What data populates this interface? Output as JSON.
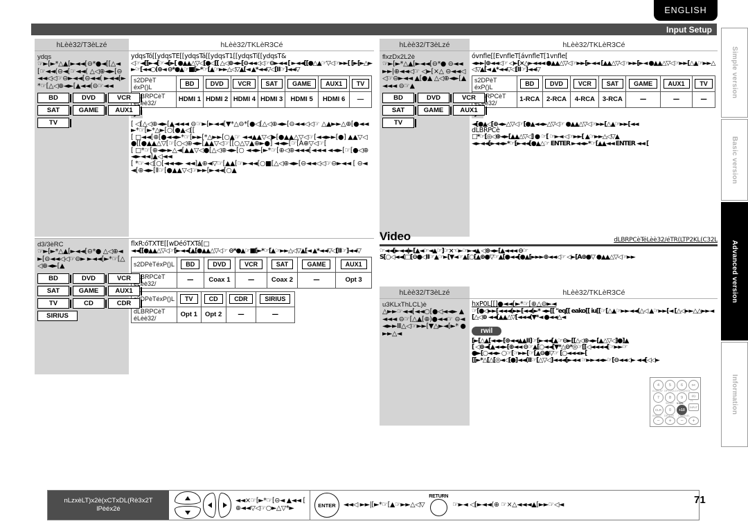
{
  "language_tab": {
    "label": "ENGLISH"
  },
  "page_header": {
    "title": "Input Setup"
  },
  "side_tabs": [
    {
      "label": "Simple version",
      "active": false
    },
    {
      "label": "Basic version",
      "active": false
    },
    {
      "label": "Advanced version",
      "active": true
    },
    {
      "label": "Information",
      "active": false
    }
  ],
  "panels": {
    "top_left": {
      "header_left": "hLèè32/T3èLzé",
      "header_right": "hLèè32/TKLèR3Cé",
      "left_title": "ydqs",
      "left_body": "☞►[►*△▲[►◄◄[⊖*●◄[[△◄[☞◄◄(⊖◄[☞◄◄( △◁⊕◄►[⊖◄◄◁◁☞⊖►◄◄[⊖◄◄( ►◄◄[►*☞[△◁⊕◄►[▲◄◄(⊖☞◄◄",
      "right_title": "ydqsTó[[ydqsTE[[ydqsTá[[ydqsT1[[ydqsTi[[ydqsT&",
      "right_body": "◁☞◄[[►◄[☞◄[►[ ●▲▲△▽◁[●◁[[ △◁⊕◄►[⊖◄◄◁◁☞⊖►◄◄ [ ►◄◄[[●△▲☞▽◁☞►►[ [►[►△►►☞[◄◄○(⊕◄ ⊖*●▲☞■[►*☞[▲☞►►△◁▽▲[◄ ▲*◄◄▽◁[Ⅱ☞]◄◄▽",
      "keys": [
        "BD",
        "DVD",
        "VCR",
        "SAT",
        "GAME",
        "AUX1",
        "TV"
      ],
      "tables": [
        {
          "row1_label": "s2DPèT éxP()L",
          "row2_label": "dLBRPCèT éLèè32/",
          "keys": [
            "BD",
            "DVD",
            "VCR",
            "SAT",
            "GAME",
            "AUX1",
            "TV"
          ],
          "values": [
            "HDMI 1",
            "HDMI 2",
            "HDMI 4",
            "HDMI 3",
            "HDMI 5",
            "HDMI 6",
            "—"
          ]
        }
      ],
      "notes": [
        "[ ◁[△◁⊕◄►[▲◄◄◄ ⊖☞►[►◄◄[▼*△⊖*[●◁[△◁⊕◄►[⊖◄◄◁◁☞ △▲►►△⊕[●◄◄►*☞[►*△►[○[●▲◁[[",
        "[ □◄◄[⊕[●◄◄►*☞[►►[*△►►[○▲☞ ◄◄▲▲▽◁▶[●▲▲△▽◁☞[◄◄►►[●] ▲▲▽◁●[[●▲▲△▽[☞[○◁⊕◄►[▲▲▽◁☞[[○△▽▲⊕►●] ◄◄►[☞[A⊕▽◁☞[",
        "[ □*☞[⊕◄►►△◄[▲▲▽◁●[△◁⊕◄►[○ ◄◄►[►*☞[⊕◁⊕◄◄◄[◄◄◄ ◄◄►[☞[●◁⊕◄►◄◄]▲◁◄◄",
        "[ *☞◄◁[○[◄◄◄► ◄◄]▲⊕◄▽☞[▲▲[☞►◄◄[○■[△◁⊕◄►[⊖◄◄◁◁☞⊖►◄◄ [ ⊖◄◄[⊕◄►[Ⅱ☞[●▲▲▽◁☞►►[►◄◄[○▲"
      ]
    },
    "top_right": {
      "header_left": "hLèè32/T3èLzé",
      "header_right": "hLèè32/TKLèR3Cé",
      "left_title": "flxzDx2L2è",
      "left_body": "☞►[►*△▲[►◄◄[⊖*● ⊖◄◄►►|⊕◄◄◁☞ ◁►[×△ ⊖◄◄◁◁☞⊖►◄◄ ▲[●▲ △◁⊕◄►[▲◄◄◄ ⊖☞▲",
      "right_title": "óvnfle[[EvnfleT[ávnfleT[1vnfle[",
      "right_body": "◄►►|⊕◄◄◁☞ ◁►[×△►◄◄◄ ●▲▲△▽◁☞►►[►◄◄ [▲▲△▽◁☞►►[►◄ ●▲▲△▽◁☞►►[△▲☞►►△◁▽▲[◄ ▲*◄◄▽◁[Ⅱ☞]◄◄▽",
      "keys": [
        "BD",
        "DVD",
        "VCR",
        "SAT",
        "GAME",
        "AUX1",
        "TV"
      ],
      "tables": [
        {
          "row1_label": "s2DPèT éxP()L",
          "row2_label": "dLBRPCèT éLèè32/",
          "keys": [
            "BD",
            "DVD",
            "VCR",
            "SAT",
            "GAME",
            "AUX1",
            "TV"
          ],
          "values": [
            "1-RCA",
            "2-RCA",
            "4-RCA",
            "3-RCA",
            "—",
            "—",
            "—"
          ]
        }
      ],
      "notes": [
        "◄[●▲◁[⊕◄►△▽◁☞[●▲◄◄►△▽◁☞ ●▲▲△▽◁☞►►[△▲☞►►[◄◄",
        "dLBRPCè",
        "□*☞[◎◁⊕◄►[▲▲△▽◁] ● ☞[ ☞►◄ ◁☞►►[ ▲☞►►△◁▽▲",
        "◄►◄◄[►◄◄►*☞[►◄◄[●▲△☞ ENTER ►◄◄►*☞[▲▲◄◄ ENTER ◄◄ ["
      ]
    },
    "bottom_left": {
      "header_left": "",
      "left_title": "d3/3èRC",
      "left_body": "☞►[►*△▲[►◄◄[⊖*● △◁⊕◄►[⊖◄◄◁◁☞⊖► ►◄◄[►*☞[△◁⊕◄►[▲",
      "right_title": "flxR:óTXTE[[wDéóTXTá[□",
      "right_body": "◄◄[[●▲▲△▽◁☞[►◄◄[▲[●▲▲△▽◁☞ ⊖*●▲☞■[►*☞[▲☞►►△◁▽▲[◄ ▲*◄◄▽◁[Ⅱ☞]◄◄▽",
      "keys": [
        "BD",
        "DVD",
        "VCR",
        "SAT",
        "GAME",
        "AUX1",
        "TV",
        "CD",
        "CDR",
        "SIRIUS"
      ],
      "tables": [
        {
          "row1_label": "s2DPèTéxP()L",
          "row2_label": "dLBRPCèT éLèè32/",
          "keys": [
            "BD",
            "DVD",
            "VCR",
            "SAT",
            "GAME",
            "AUX1"
          ],
          "values": [
            "—",
            "Coax 1",
            "—",
            "Coax 2",
            "—",
            "Opt 3"
          ]
        },
        {
          "row1_label": "s2DPèTéxP()L",
          "row2_label": "dLBRPCèT éLèè32/",
          "keys": [
            "TV",
            "CD",
            "CDR",
            "SIRIUS"
          ],
          "values": [
            "Opt 1",
            "Opt 2",
            "—",
            "—"
          ]
        }
      ]
    },
    "video_section": {
      "title": "Video",
      "reference": "dLBRPCèTéLèè32/éTR(LTP2KL(C32L",
      "body1": "☞◄◄[►◄◄|►[▲◄☞◄▲☞]☞×☜►☞►◄▲ ◁⊕◄►[▲◄◄◄ ⊖☞",
      "body2": "S[○◁◄◄(□[⊖●◁Ⅱ☞▲☞►[▼◄☞▲[○[▲⊕●▽☞▲[●◄◄[●▲[►►►⊕◄◄◁☞ ◁►[A⊕●▽ ●▲▲△▽◁☞►►"
    },
    "bottom_right": {
      "header_left": "hLèè32/T3èLzé",
      "header_right": "hLèè32/TKLèR3Cé",
      "left_title": "u3KLxThLCL)è",
      "left_body": "△►►☞◄◄[◄◄○[●◁◄◄► ▲◄◄◄ ⊖☞[△▲[⊕)●◄◄☞ ⊖◄◄►►Ⅲ△◁☞►►[▼△►◄[►* ●►►△◄",
      "right_title": "hxP0L[[]●◄◄[►*☞[⊕△⊖►◄",
      "right_body": "☞[●◁►►[◄◄◄(►►[◄◄(►* ◄►[[ \"eq[[ eako[[ iu[[☞[△▲☞►►◄◄(△◁ ▲☞►►[◄ [△◁►►△△►►◄[△◁⊕ ◄◄[▲▲△▽[◄◄◄(▼*◄ ●◄◄△◄",
      "pill": "rwil",
      "notes": [
        "[►[△▲[◄◄►[⊕◄◄▲▲Ⅱ]☞[►◄◄[▲☞⊖►[[△◁⊕◄►[▲△▽◁]●]▲",
        "[ ◁⊕◄[▲◄◄►[⊕◄◄ ⊖☞▲[○◄◄[▼*△⊖*◎☞[[◁◄◄◄◄[☞►►☞",
        "●►[○◄◄► ○☞[☞►►[☞[▲⊖●▽☞ [○◄◄◄ ►[",
        "[[►*△[△[◎◄◁[●]◄◄(Ⅱ☞[△▽◁]◄◄◄[►◄◄ ☞►►◄◄►☞[⊖◄◄◁► ◄◄[◁◁►"
      ]
    }
  },
  "remote": {
    "keys": [
      "4",
      "5",
      "6",
      "7",
      "8",
      "9",
      "CLR",
      "0",
      "+10"
    ],
    "captions": [
      "A.DELAY",
      "OPT/VOL",
      "DYN.EQ/VOL",
      "SLEEP",
      "V.SEL",
      "INSERT",
      "DELETE",
      "CHANNEL",
      "TUNING",
      "PRESET"
    ],
    "side_keys": [
      "I/⏻",
      "TV",
      "INPUT"
    ]
  },
  "bottom_bar": {
    "label_line1": "nLzxèLT)x2è(xCTxDL(Rè3x2T",
    "label_line2": "lPèéx2é",
    "cursor_text1": "◄◄×☞[►*☞[⊖◄ ▲◄◄ [",
    "cursor_text2": "⊕◄◄▽◁☞○►△▽*►",
    "enter_label": "ENTER",
    "enter_text": "◄◄◁ ►►|[►*☞[▲☞►►△◁▽",
    "return_label": "RETURN",
    "return_text": "☞►◄ ◁[►◄◄(⊕ ☞×△◄◄◄▲[►►☞◁◄"
  },
  "page_number": "71"
}
